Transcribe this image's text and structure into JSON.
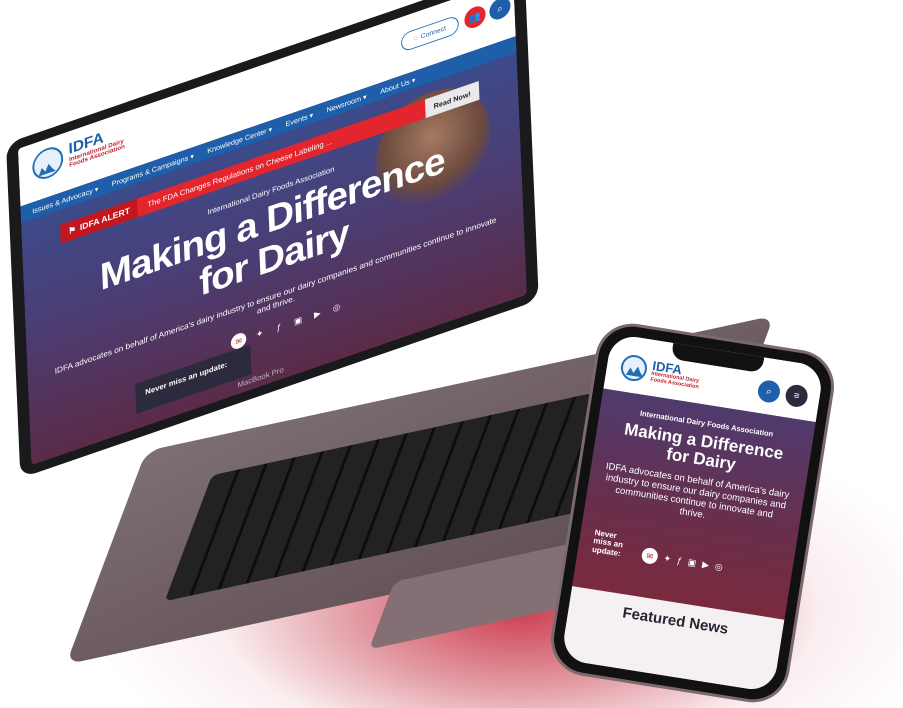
{
  "brand": {
    "logo_text": "IDFA",
    "logo_subtitle": "International Dairy Foods Association",
    "colors": {
      "blue": "#1f5fa9",
      "red": "#e3252d",
      "navy": "#2c2b3d"
    }
  },
  "laptop": {
    "header": {
      "connect_label": "Connect",
      "connect_icon": "chat-icon",
      "people_icon": "people-icon",
      "search_icon": "search-icon"
    },
    "nav": [
      {
        "label": "Issues & Advocacy ▾"
      },
      {
        "label": "Programs & Campaigns ▾"
      },
      {
        "label": "Knowledge Center ▾"
      },
      {
        "label": "Events ▾"
      },
      {
        "label": "Newsroom ▾"
      },
      {
        "label": "About Us ▾"
      }
    ],
    "alert": {
      "label": "IDFA ALERT",
      "text": "The FDA Changes Regulations on Cheese Labeling ...",
      "read_now": "Read Now!"
    },
    "hero": {
      "kicker": "International Dairy Foods Association",
      "title_line1": "Making a Difference",
      "title_line2": "for Dairy",
      "subtitle": "IDFA advocates on behalf of America's dairy industry to ensure our dairy companies and communities continue to innovate and thrive."
    },
    "newsletter_label": "Never miss an update:",
    "social_icons": [
      "email-icon",
      "twitter-icon",
      "facebook-icon",
      "linkedin-icon",
      "youtube-icon",
      "instagram-icon"
    ],
    "device_label": "MacBook Pro"
  },
  "phone": {
    "hero": {
      "kicker": "International Dairy Foods Association",
      "title_line1": "Making a Difference",
      "title_line2": "for Dairy",
      "subtitle": "IDFA advocates on behalf of America's dairy industry to ensure our dairy companies and communities continue to innovate and thrive."
    },
    "newsletter_label": "Never miss an update:",
    "featured_title": "Featured News"
  }
}
